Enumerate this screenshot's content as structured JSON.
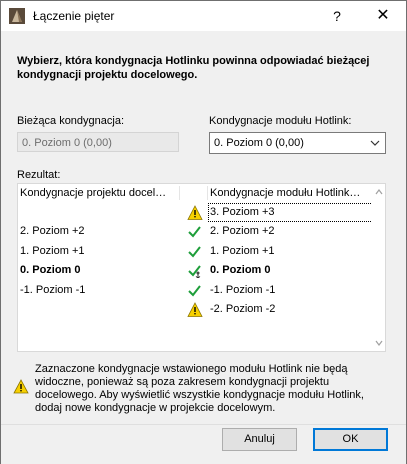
{
  "window": {
    "title": "Łączenie pięter",
    "help_label": "?",
    "close_label": "✕"
  },
  "instruction": "Wybierz, która kondygnacja Hotlinku powinna odpowiadać bieżącej kondygnacji projektu docelowego.",
  "current_story": {
    "label": "Bieżąca kondygnacja:",
    "value": "0. Poziom 0 (0,00)"
  },
  "hotlink_story": {
    "label": "Kondygnacje modułu Hotlink:",
    "selected": "0. Poziom 0 (0,00)"
  },
  "result": {
    "label": "Rezultat:",
    "columns": [
      "Kondygnacje projektu docel…",
      "",
      "Kondygnacje modułu Hotlink…"
    ],
    "rows": [
      {
        "left": "",
        "status": "warning",
        "right": "3. Poziom +3",
        "bold": false,
        "focused": true
      },
      {
        "left": "2. Poziom +2",
        "status": "check",
        "right": "2. Poziom +2",
        "bold": false,
        "focused": false
      },
      {
        "left": "1. Poziom +1",
        "status": "check",
        "right": "1. Poziom +1",
        "bold": false,
        "focused": false
      },
      {
        "left": "0. Poziom 0",
        "status": "check-anchor",
        "right": "0. Poziom 0",
        "bold": true,
        "focused": false
      },
      {
        "left": "-1. Poziom -1",
        "status": "check",
        "right": "-1. Poziom -1",
        "bold": false,
        "focused": false
      },
      {
        "left": "",
        "status": "warning",
        "right": "-2. Poziom -2",
        "bold": false,
        "focused": false
      }
    ]
  },
  "note": "Zaznaczone kondygnacje wstawionego modułu Hotlink nie będą widoczne, ponieważ są poza zakresem kondygnacji projektu docelowego. Aby wyświetlić wszystkie kondygnacje modułu Hotlink, dodaj nowe kondygnacje w projekcie docelowym.",
  "buttons": {
    "cancel": "Anuluj",
    "ok": "OK"
  },
  "colors": {
    "check": "#1e9e3a",
    "warning_fill": "#f7d000",
    "accent": "#0078d7"
  },
  "icons": {
    "app": "archicad-icon",
    "warning": "warning-icon",
    "check": "check-icon",
    "anchor": "anchor-icon"
  }
}
